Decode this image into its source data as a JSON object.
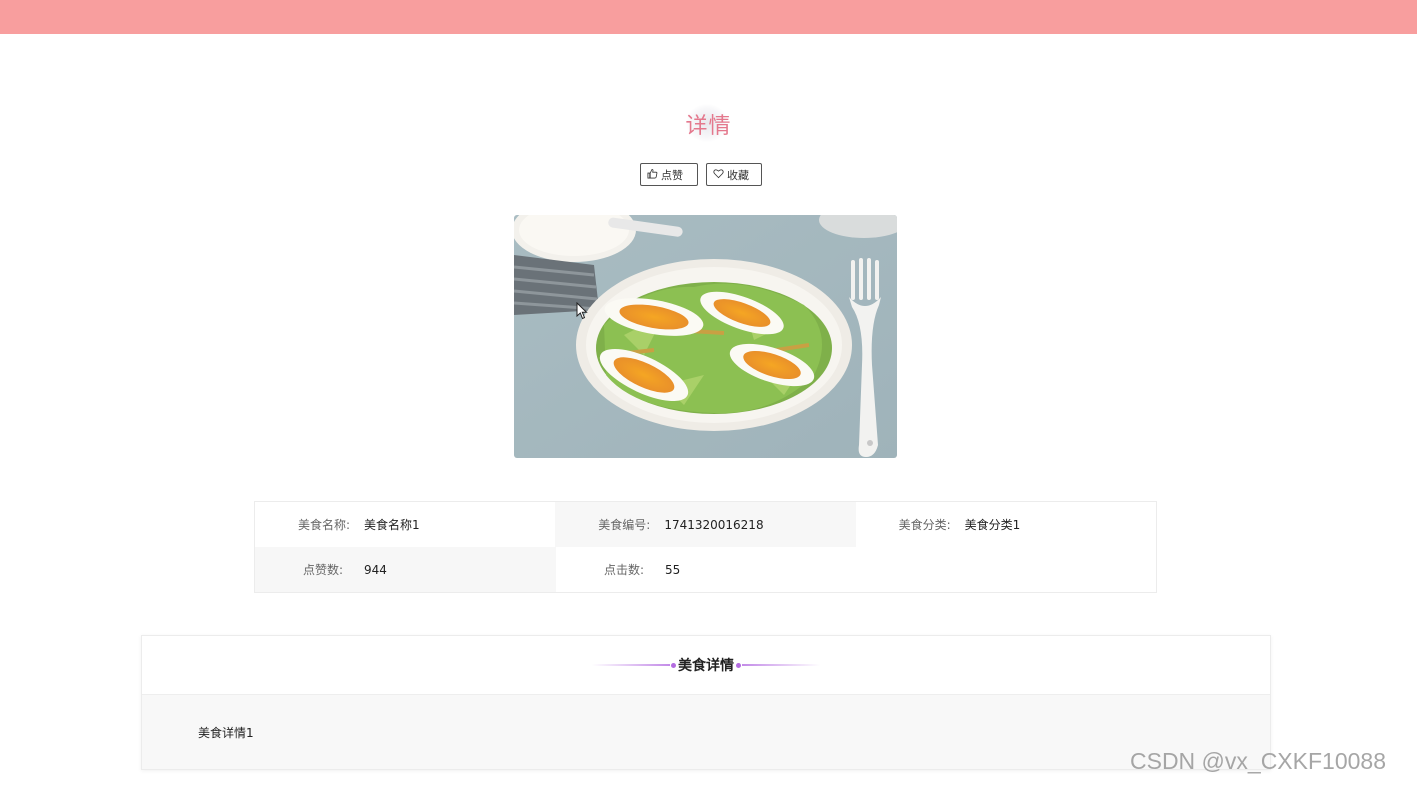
{
  "header": {
    "bar_color": "#f89e9e"
  },
  "page": {
    "title": "详情"
  },
  "actions": {
    "like_label": "点赞",
    "like_icon": "thumbs-up-icon",
    "favorite_label": "收藏",
    "favorite_icon": "heart-icon"
  },
  "food": {
    "image_icon": "salad-photo"
  },
  "info": {
    "rows": [
      [
        {
          "label": "美食名称:",
          "value": "美食名称1"
        },
        {
          "label": "美食编号:",
          "value": "1741320016218"
        },
        {
          "label": "美食分类:",
          "value": "美食分类1"
        }
      ],
      [
        {
          "label": "点赞数:",
          "value": "944"
        },
        {
          "label": "点击数:",
          "value": "55"
        }
      ]
    ]
  },
  "detail": {
    "title": "美食详情",
    "content": "美食详情1",
    "accent_color": "#b36be0"
  },
  "watermark": "CSDN @vx_CXKF10088"
}
